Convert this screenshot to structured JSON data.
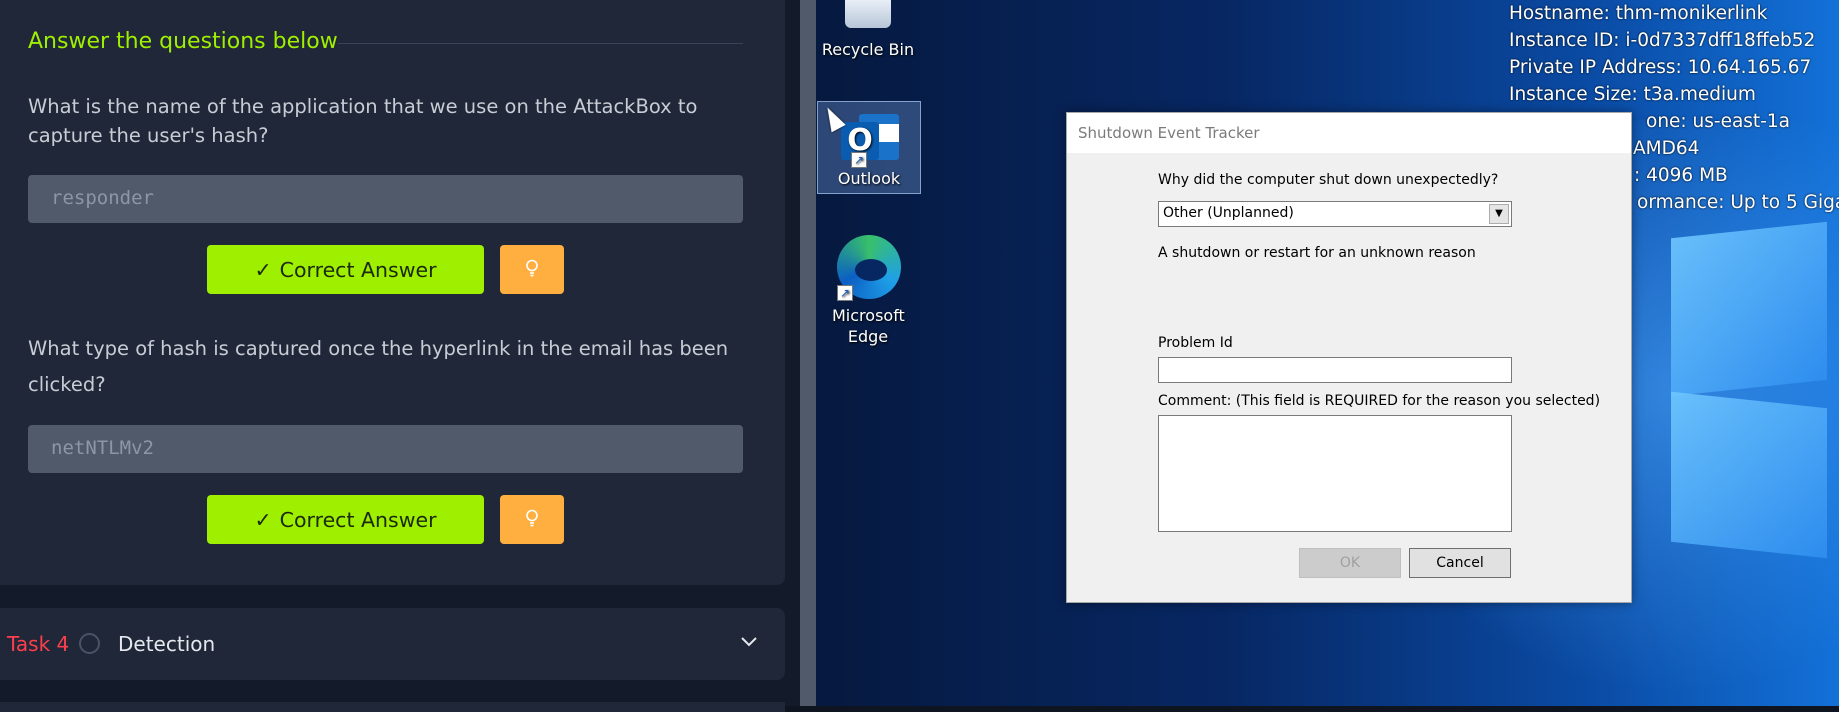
{
  "room": {
    "section_title": "Answer the questions below",
    "questions": [
      {
        "text": "What is the name of the application that we use on the AttackBox to capture the user's hash?",
        "answer": "responder",
        "correct_label": "Correct Answer"
      },
      {
        "text": "What type of hash is captured once the hyperlink in the email has been clicked?",
        "answer": "netNTLMv2",
        "correct_label": "Correct Answer"
      }
    ],
    "check_icon": "check-icon",
    "hint_icon": "lightbulb-icon",
    "next_task": {
      "label": "Task 4",
      "title": "Detection",
      "chevron": "chevron-down-icon"
    },
    "colors": {
      "accent_green": "#9fef00",
      "hint_orange": "#ffaf40",
      "task_red": "#ff3e4d"
    }
  },
  "desktop": {
    "icons": [
      {
        "label": "Recycle Bin",
        "icon": "recycle-bin-icon"
      },
      {
        "label": "Outlook",
        "icon": "outlook-icon"
      },
      {
        "label": "Microsoft Edge",
        "icon": "edge-icon"
      }
    ],
    "bginfo": [
      "Hostname: thm-monikerlink",
      "Instance ID: i-0d7337dff18ffeb52",
      "Private IP Address: 10.64.165.67",
      "Instance Size: t3a.medium",
      "one: us-east-1a",
      "AMD64",
      ": 4096 MB",
      "ormance: Up to 5 Giga"
    ]
  },
  "dialog": {
    "title": "Shutdown Event Tracker",
    "question": "Why did the computer shut down unexpectedly?",
    "selected_option": "Other (Unplanned)",
    "description": "A shutdown or restart for an unknown reason",
    "problem_id_label": "Problem Id",
    "problem_id_value": "",
    "comment_label": "Comment: (This field is REQUIRED for the reason you selected)",
    "comment_value": "",
    "ok_label": "OK",
    "cancel_label": "Cancel"
  }
}
